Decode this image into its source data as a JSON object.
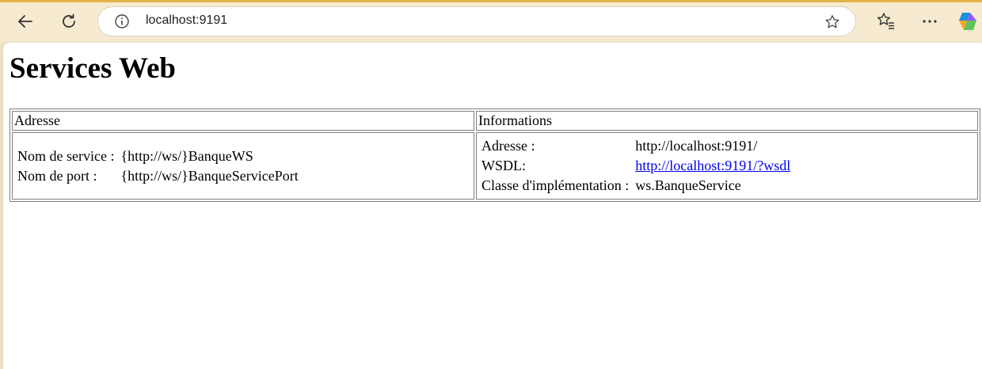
{
  "browser": {
    "url": "localhost:9191",
    "icons": {
      "back": "arrow-left-icon",
      "reload": "reload-icon",
      "site_info": "info-icon",
      "bookmark": "star-icon",
      "favorites": "favorites-icon",
      "more": "more-icon",
      "copilot": "copilot-icon"
    }
  },
  "page": {
    "title": "Services Web",
    "table": {
      "headers": {
        "address": "Adresse",
        "info": "Informations"
      },
      "service": {
        "name_label": "Nom de service :",
        "name_value": "{http://ws/}BanqueWS",
        "port_label": "Nom de port :",
        "port_value": "{http://ws/}BanqueServicePort"
      },
      "info": {
        "address_label": "Adresse :",
        "address_value": "http://localhost:9191/",
        "wsdl_label": "WSDL:",
        "wsdl_value": "http://localhost:9191/?wsdl",
        "impl_label": "Classe d'implémentation :",
        "impl_value": "ws.BanqueService"
      }
    }
  }
}
